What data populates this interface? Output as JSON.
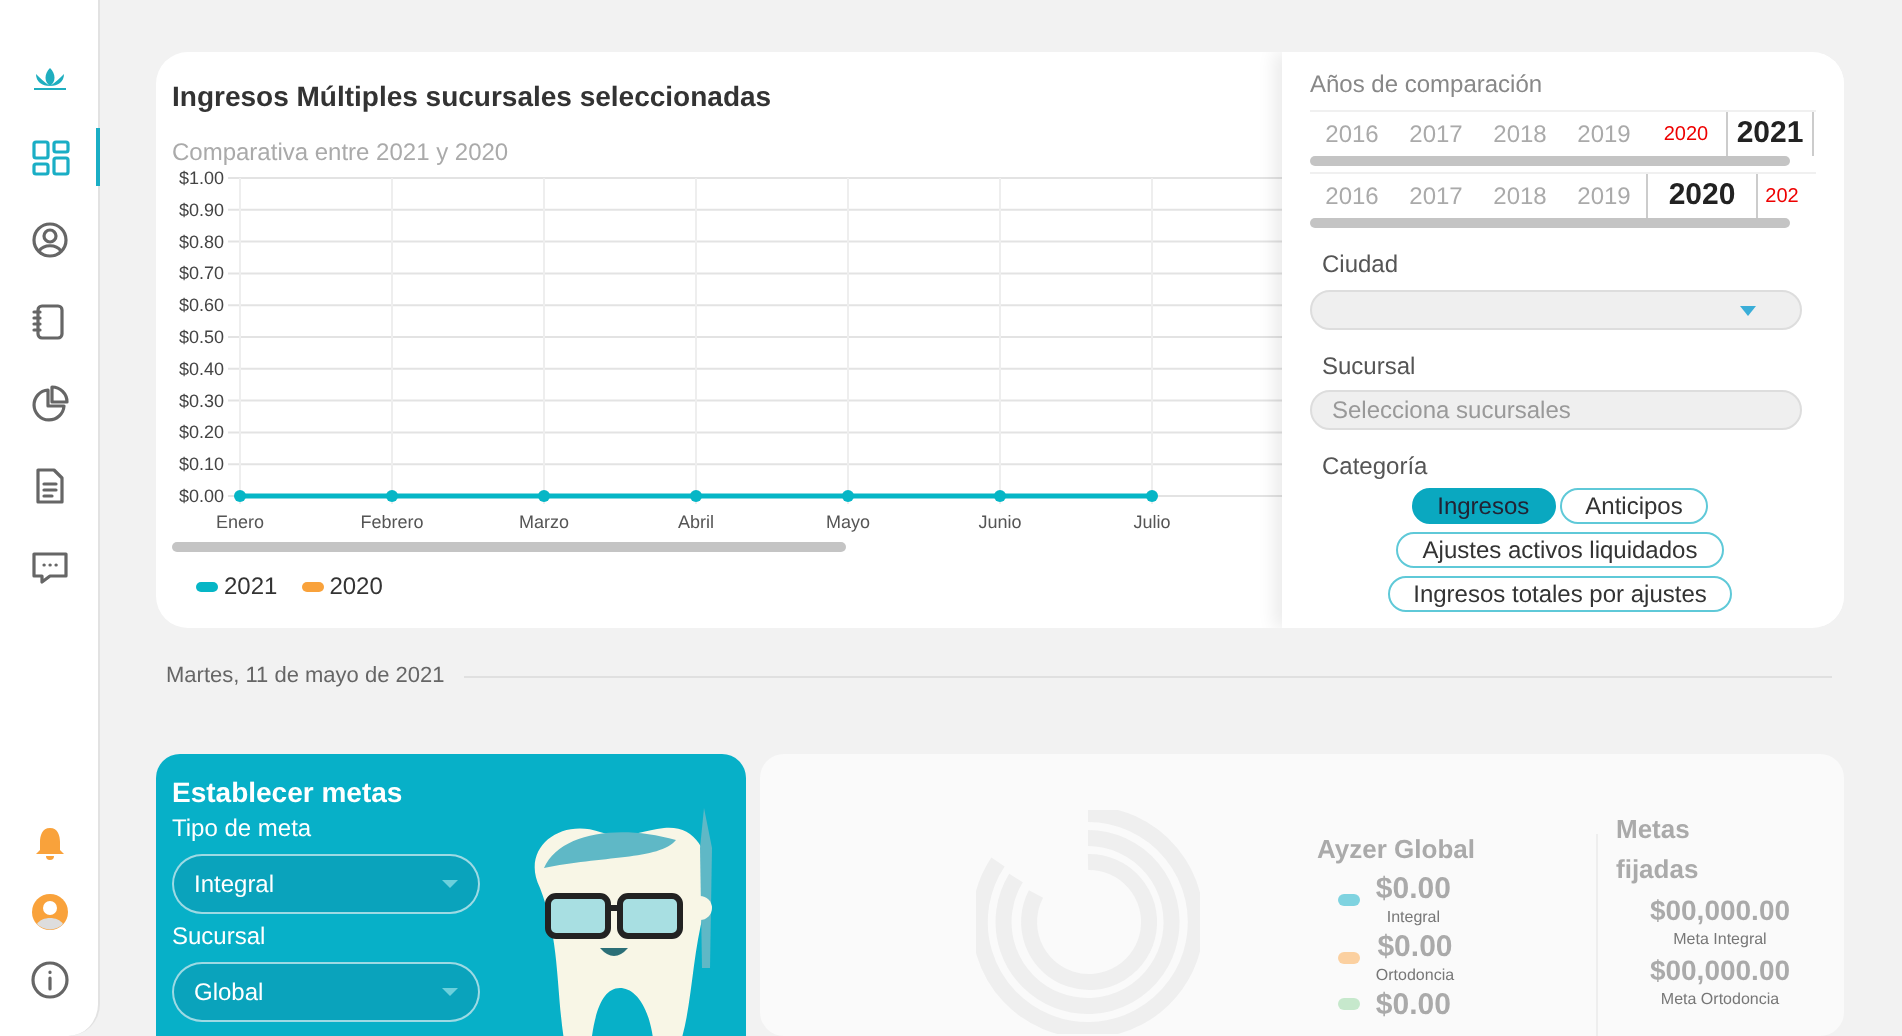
{
  "sidebar": {
    "items": [
      {
        "selected": true
      },
      {
        "selected": false
      },
      {
        "selected": false
      },
      {
        "selected": false
      },
      {
        "selected": false
      },
      {
        "selected": false
      }
    ]
  },
  "income_card": {
    "title": "Ingresos Múltiples sucursales seleccionadas",
    "subtitle": "Comparativa entre 2021 y 2020",
    "chart_data": {
      "type": "line",
      "grid": true,
      "categories": [
        "Enero",
        "Febrero",
        "Marzo",
        "Abril",
        "Mayo",
        "Junio",
        "Julio"
      ],
      "series": [
        {
          "name": "2021",
          "color": "#06b6c6",
          "marker": true,
          "values": [
            0,
            0,
            0,
            0,
            0,
            0,
            0
          ]
        },
        {
          "name": "2020",
          "color": "#f9a23b",
          "values": [
            null,
            null,
            null,
            null,
            null,
            null,
            null
          ]
        }
      ],
      "ylim": [
        0,
        1
      ],
      "yticks": [
        {
          "value": 0,
          "label": "$0.00"
        },
        {
          "value": 0.1,
          "label": "$0.10"
        },
        {
          "value": 0.2,
          "label": "$0.20"
        },
        {
          "value": 0.3,
          "label": "$0.30"
        },
        {
          "value": 0.4,
          "label": "$0.40"
        },
        {
          "value": 0.5,
          "label": "$0.50"
        },
        {
          "value": 0.6,
          "label": "$0.60"
        },
        {
          "value": 0.7,
          "label": "$0.70"
        },
        {
          "value": 0.8,
          "label": "$0.80"
        },
        {
          "value": 0.9,
          "label": "$0.90"
        },
        {
          "value": 1,
          "label": "$1.00"
        }
      ]
    }
  },
  "filters": {
    "years_title": "Años de comparación",
    "year_rows": [
      [
        {
          "label": "2016",
          "selected": false,
          "compared": false
        },
        {
          "label": "2017",
          "selected": false,
          "compared": false
        },
        {
          "label": "2018",
          "selected": false,
          "compared": false
        },
        {
          "label": "2019",
          "selected": false,
          "compared": false
        },
        {
          "label": "2020",
          "selected": false,
          "compared": true
        },
        {
          "label": "2021",
          "selected": true,
          "compared": false
        }
      ],
      [
        {
          "label": "2016",
          "selected": false,
          "compared": false
        },
        {
          "label": "2017",
          "selected": false,
          "compared": false
        },
        {
          "label": "2018",
          "selected": false,
          "compared": false
        },
        {
          "label": "2019",
          "selected": false,
          "compared": false
        },
        {
          "label": "2020",
          "selected": true,
          "compared": false
        },
        {
          "label": "202",
          "selected": false,
          "compared": true
        }
      ]
    ],
    "city_label": "Ciudad",
    "branch_label": "Sucursal",
    "branch_placeholder": "Selecciona sucursales",
    "category_label": "Categoría",
    "categories": [
      {
        "label": "Ingresos",
        "selected": true
      },
      {
        "label": "Anticipos",
        "selected": false
      },
      {
        "label": "Ajustes activos liquidados",
        "selected": false
      },
      {
        "label": "Ingresos totales por ajustes",
        "selected": false
      }
    ]
  },
  "date": "Martes, 11 de mayo de 2021",
  "goals": {
    "title": "Establecer metas",
    "fields": [
      {
        "label": "Tipo de meta",
        "value": "Integral"
      },
      {
        "label": "Sucursal",
        "value": "Global"
      }
    ]
  },
  "summary": {
    "title": "Ayzer Global",
    "items": [
      {
        "amount": "$0.00",
        "label": "Integral",
        "color": "#7fd3e0"
      },
      {
        "amount": "$0.00",
        "label": "Ortodoncia",
        "color": "#fbd0a0"
      },
      {
        "amount": "$0.00",
        "color": "#c6e8cc"
      }
    ],
    "goals_title": "Metas fijadas",
    "goal_items": [
      {
        "amount": "$00,000.00",
        "label": "Meta Integral"
      },
      {
        "amount": "$00,000.00",
        "label": "Meta Ortodoncia"
      }
    ]
  }
}
